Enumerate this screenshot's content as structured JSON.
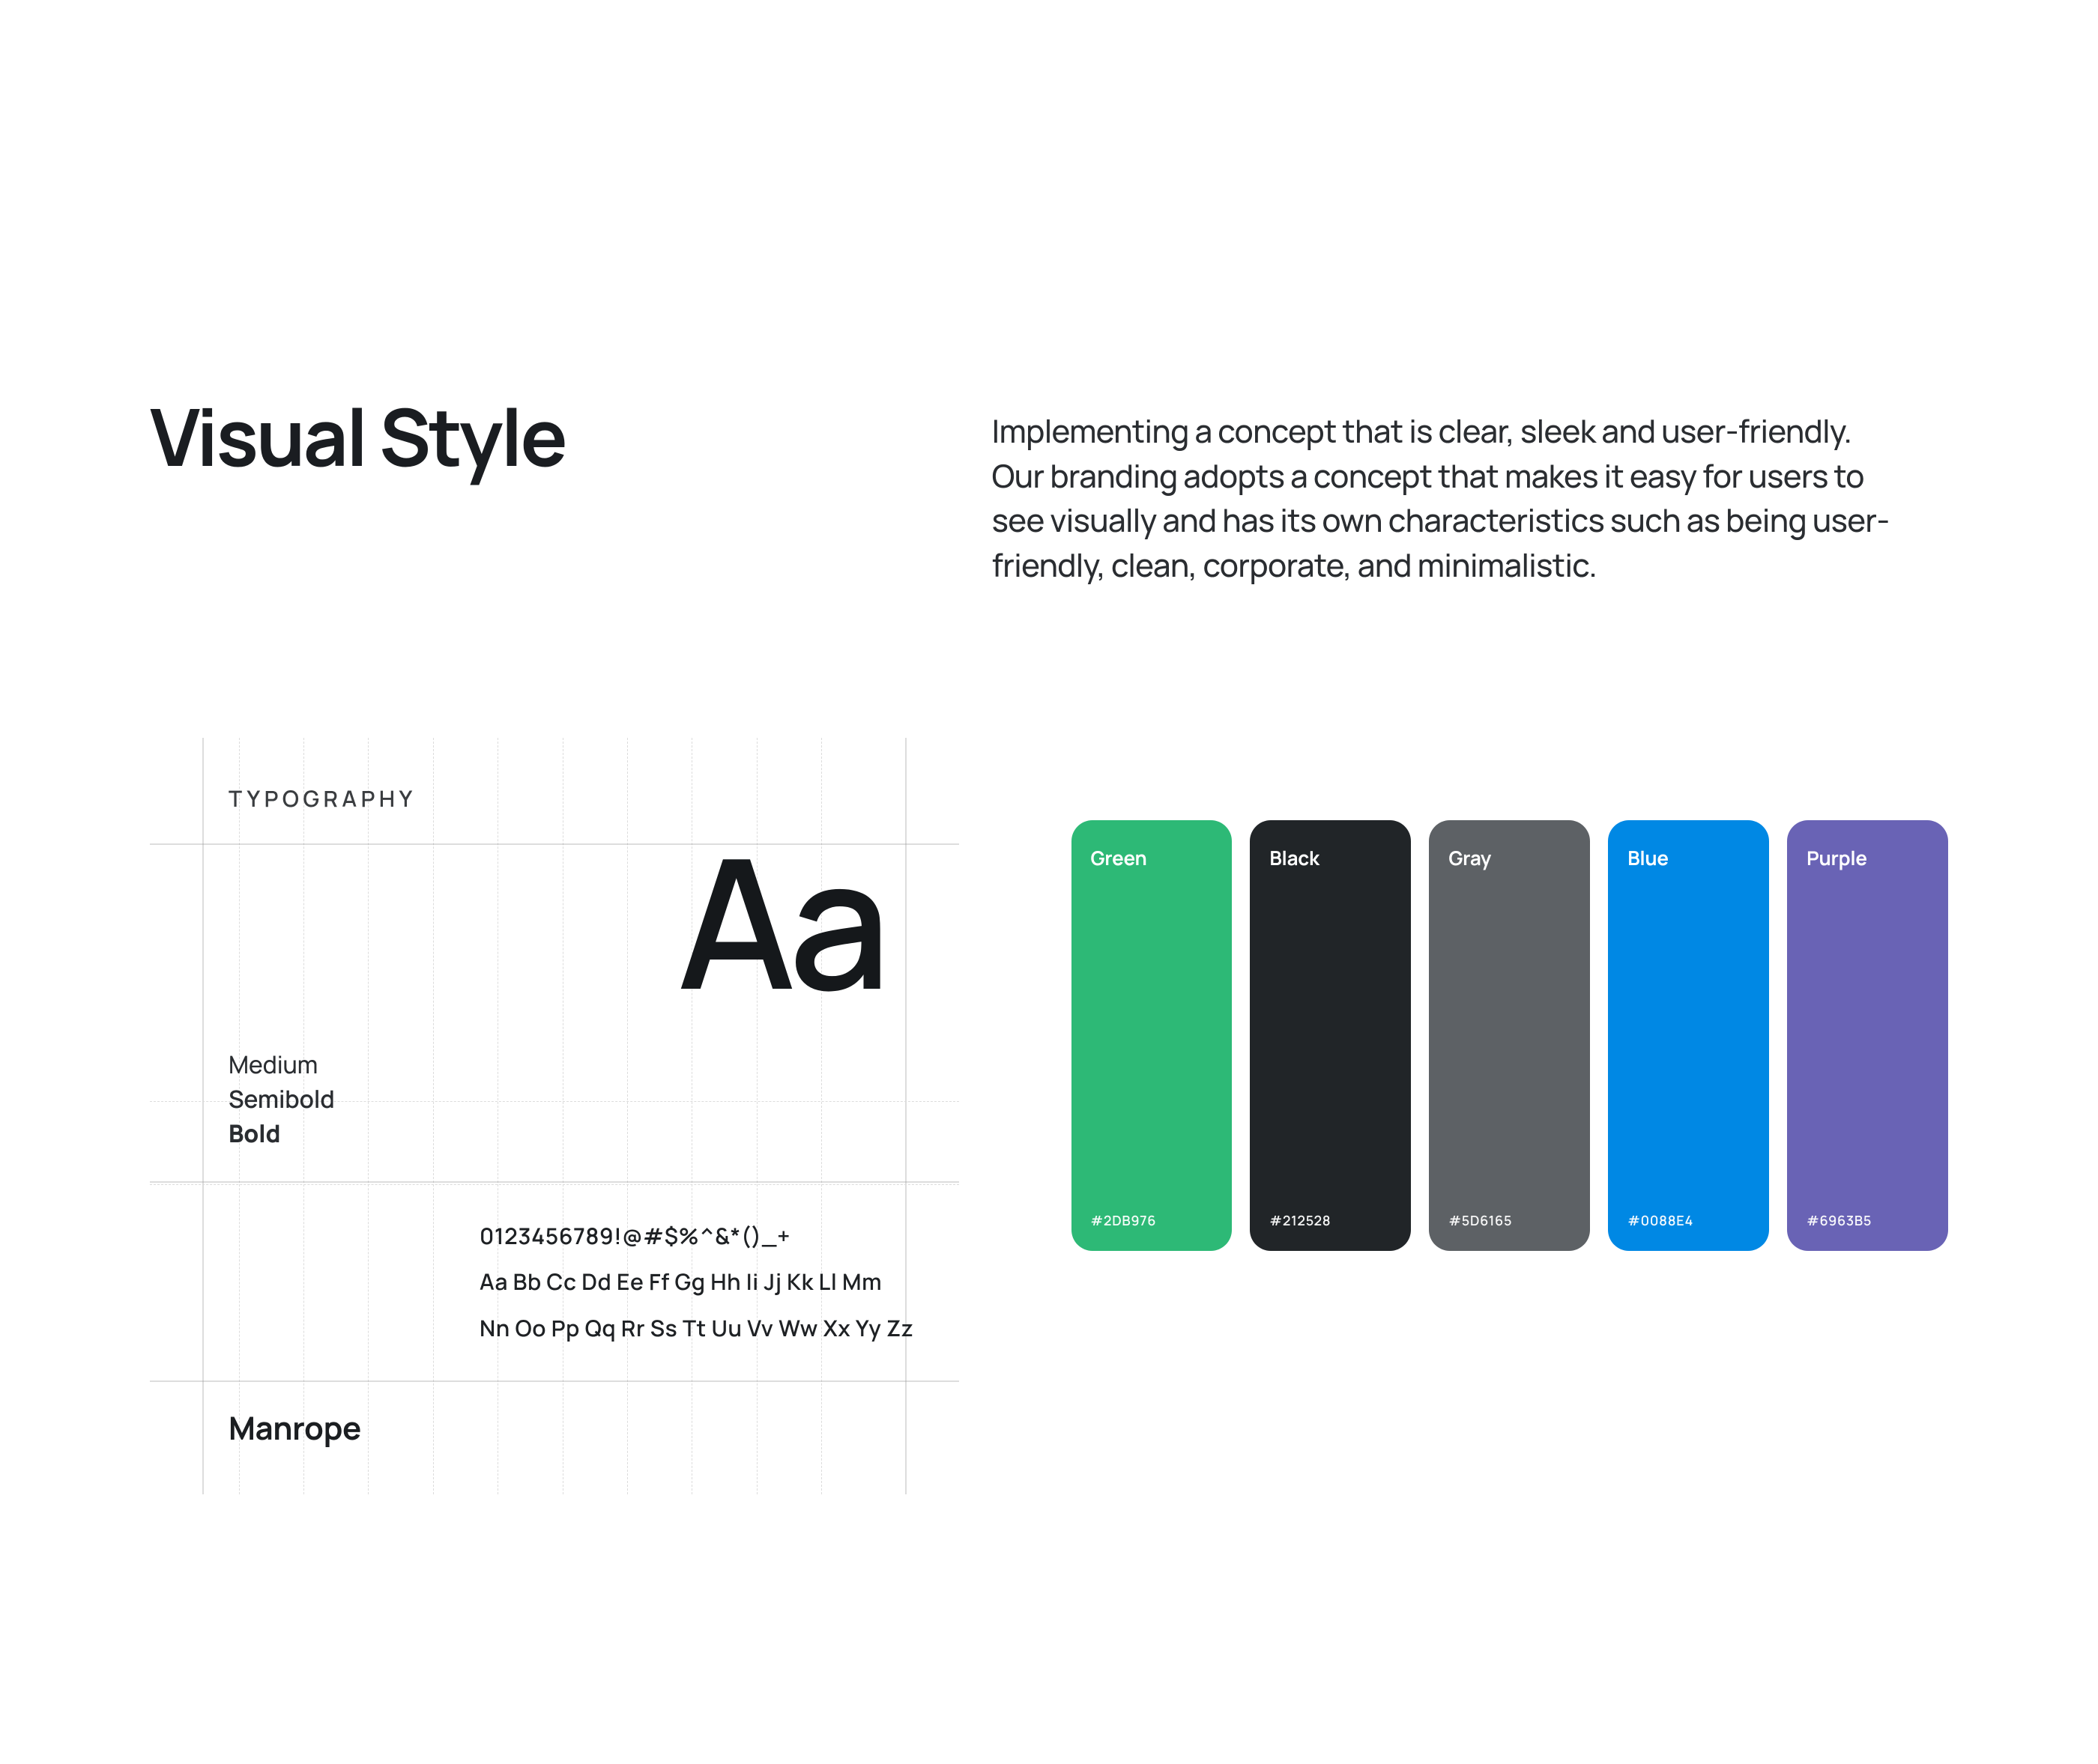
{
  "header": {
    "title": "Visual Style",
    "description": "Implementing a concept that is clear, sleek and user-friendly. Our branding adopts a concept that makes it easy for users to see visually and has its own characteristics such as being user-friendly, clean, corporate, and minimalistic."
  },
  "typography": {
    "section_label": "TYPOGRAPHY",
    "specimen": "Aa",
    "weights": {
      "medium": "Medium",
      "semibold": "Semibold",
      "bold": "Bold"
    },
    "char_row_numbers": "0123456789!@#$%^&*()_+",
    "char_row_upper": "Aa  Bb  Cc  Dd  Ee  Ff  Gg  Hh  Ii  Jj  Kk  Ll  Mm",
    "char_row_lower": "Nn  Oo  Pp  Qq  Rr  Ss  Tt  Uu  Vv  Ww  Xx  Yy  Zz",
    "font_name": "Manrope"
  },
  "palette": [
    {
      "name": "Green",
      "hex": "#2DB976"
    },
    {
      "name": "Black",
      "hex": "#212528"
    },
    {
      "name": "Gray",
      "hex": "#5D6165"
    },
    {
      "name": "Blue",
      "hex": "#0088E4"
    },
    {
      "name": "Purple",
      "hex": "#6963B5"
    }
  ]
}
